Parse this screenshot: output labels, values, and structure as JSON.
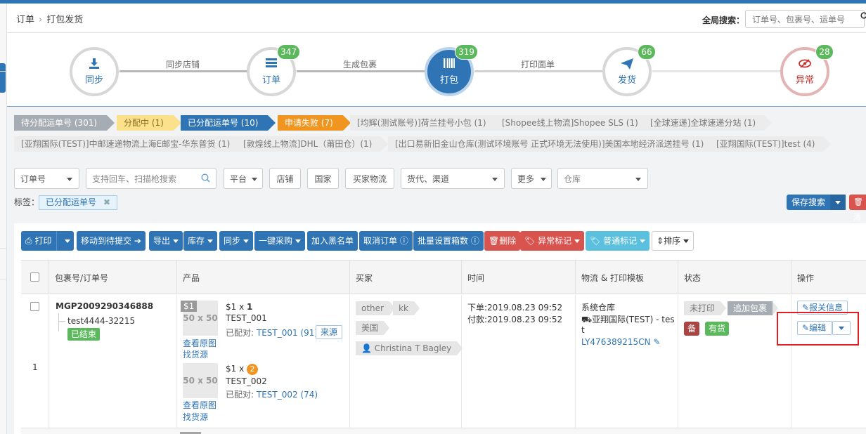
{
  "breadcrumb": {
    "root": "订单",
    "current": "打包发货"
  },
  "global_search": {
    "label": "全局搜索：",
    "placeholder": "订单号、包裹号、运单号"
  },
  "stepper": {
    "steps": [
      {
        "label": "同步",
        "icon": "download-icon",
        "badge": null
      },
      {
        "label": "订单",
        "icon": "list-icon",
        "badge": "347"
      },
      {
        "label": "打包",
        "icon": "barcode-icon",
        "badge": "319"
      },
      {
        "label": "发货",
        "icon": "send-icon",
        "badge": "66"
      },
      {
        "label": "异常",
        "icon": "eye-slash-icon",
        "badge": "28"
      }
    ],
    "connectors": [
      "同步店铺",
      "生成包裹",
      "打印面单"
    ]
  },
  "status_tabs": [
    {
      "label": "待分配运单号 (301)"
    },
    {
      "label": "分配中 (1)"
    },
    {
      "label": "已分配运单号 (10)"
    },
    {
      "label": "申请失败 (7)"
    },
    {
      "label": "[均辉(测试账号)]荷兰挂号小包 (1)"
    },
    {
      "label": "[Shopee线上物流]Shopee SLS (1)"
    },
    {
      "label": "[全球速递]全球速递分站 (1)"
    }
  ],
  "carrier_tabs": [
    {
      "label": "[亚翔国际(TEST)]中邮速递物流上海E邮宝-华东普货 (1)"
    },
    {
      "label": "[敦煌线上物流]DHL（莆田仓）(1)"
    },
    {
      "label": "[出口易新旧金山仓库(测试环境账号 正式环境无法使用)]美国本地经济派送挂号 (1)"
    },
    {
      "label": "[亚翔国际(TEST)]test (4)"
    }
  ],
  "filters": {
    "order_no": "订单号",
    "search_placeholder": "支持回车、扫描枪搜索",
    "platform": "平台",
    "shop": "店铺",
    "country": "国家",
    "buyer_logistics": "买家物流",
    "forwarder": "货代、渠道",
    "more": "更多",
    "warehouse": "仓库"
  },
  "tag_filter": {
    "label": "标签：",
    "chip": "已分配运单号",
    "chip_close": "✖"
  },
  "actions": {
    "save_search": "保存搜索",
    "delete": "🗑 清"
  },
  "toolbar": {
    "print": "打印",
    "move_pending": "移动到待提交",
    "export": "导出",
    "stock": "库存",
    "sync": "同步",
    "one_click_purchase": "一键采购",
    "blacklist": "加入黑名单",
    "cancel_order": "取消订单",
    "bulk_box": "批量设置箱数",
    "delete": "删除",
    "abnormal_mark": "异常标记",
    "normal_mark": "普通标记",
    "sort": "排序"
  },
  "table": {
    "headers": [
      "包裹号/订单号",
      "产品",
      "买家",
      "时间",
      "物流 & 打印模板",
      "状态",
      "操作"
    ],
    "row": {
      "index": "1",
      "package_no": "MGP2009290346888",
      "order_no": "test4444-32215",
      "order_status": "已结束",
      "products": [
        {
          "price": "$1",
          "qty_prefix": "$1 x ",
          "qty": "1",
          "name": "TEST_001",
          "paired_label": "已配对: ",
          "paired": "TEST_001 (91)",
          "source_btn": "来源",
          "img": "50 x 50",
          "view_img": "查看原图",
          "find_source": "找货源"
        },
        {
          "price": "",
          "qty_prefix": "$1 x ",
          "qty": "2",
          "name": "TEST_002",
          "paired_label": "已配对: ",
          "paired": "TEST_002 (74)",
          "img": "50 x 50",
          "view_img": "查看原图",
          "find_source": "找货源"
        }
      ],
      "buyer": {
        "tags": [
          "other",
          "kk"
        ],
        "country": "美国",
        "name": "Christina T Bagley"
      },
      "time": {
        "order": "下单:2019.08.23 09:52",
        "paid": "付款:2019.08.23 09:52"
      },
      "logistics": {
        "warehouse": "系统仓库",
        "carrier": "亚翔国际(TEST) - tes",
        "carrier_tail": "t",
        "tracking": "LY476389215CN"
      },
      "status": {
        "print": "未打印",
        "add_pkg": "追加包裹",
        "note": "备",
        "stock": "有货"
      },
      "ops": {
        "customs": "报关信息",
        "edit": "编辑"
      }
    }
  },
  "colors": {
    "primary": "#2f74b5",
    "danger": "#d9534f",
    "success": "#5cb85c",
    "info": "#5bc0de",
    "warning": "#f0951f"
  }
}
